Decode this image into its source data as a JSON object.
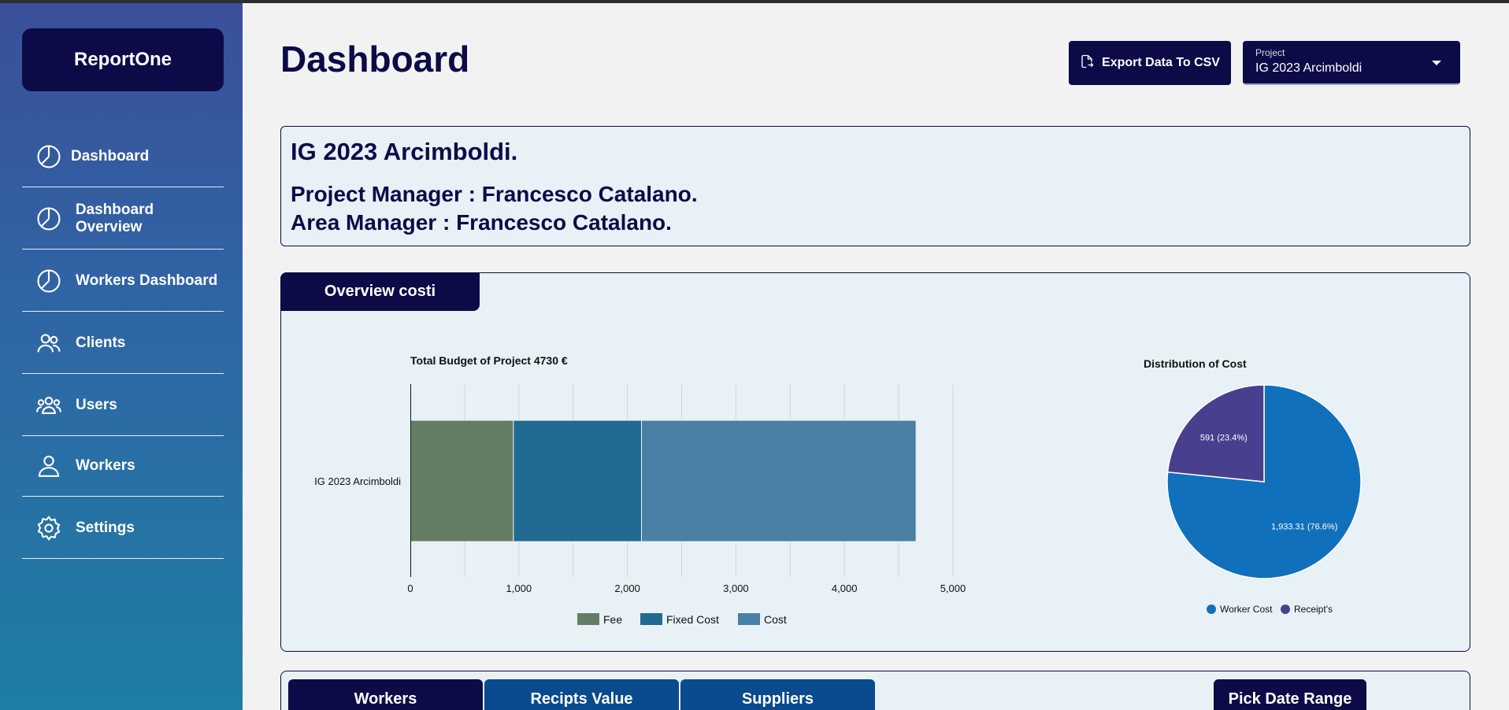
{
  "app": {
    "brand": "ReportOne"
  },
  "sidebar": {
    "items": [
      {
        "label": "Dashboard",
        "icon": "pie-chart-icon"
      },
      {
        "label": "Dashboard Overview",
        "icon": "pie-chart-icon"
      },
      {
        "label": "Workers Dashboard",
        "icon": "pie-chart-icon"
      },
      {
        "label": "Clients",
        "icon": "people-icon"
      },
      {
        "label": "Users",
        "icon": "group-icon"
      },
      {
        "label": "Workers",
        "icon": "person-icon"
      },
      {
        "label": "Settings",
        "icon": "gear-icon"
      }
    ]
  },
  "header": {
    "title": "Dashboard",
    "export_label": "Export Data To CSV",
    "export_icon": "file-export-icon",
    "project_select": {
      "label": "Project",
      "value": "IG 2023 Arcimboldi"
    }
  },
  "info": {
    "title": "IG 2023 Arcimboldi.",
    "project_manager": "Project Manager : Francesco Catalano.",
    "area_manager": "Area Manager : Francesco Catalano."
  },
  "overview": {
    "tab_label": "Overview costi"
  },
  "colors": {
    "navy": "#0d0b47",
    "fee": "#647d64",
    "fixed_cost": "#216a91",
    "cost": "#4a80a3",
    "worker_cost": "#1070bc",
    "receipts": "#48408e"
  },
  "chart_data": [
    {
      "type": "bar",
      "orientation": "horizontal",
      "stacked": true,
      "title": "Total Budget of Project 4730 €",
      "categories": [
        "IG 2023 Arcimboldi"
      ],
      "series": [
        {
          "name": "Fee",
          "values": [
            950
          ]
        },
        {
          "name": "Fixed Cost",
          "values": [
            1180
          ]
        },
        {
          "name": "Cost",
          "values": [
            2530
          ]
        }
      ],
      "xlim": [
        0,
        5000
      ],
      "x_ticks": [
        "0",
        "1,000",
        "2,000",
        "3,000",
        "4,000",
        "5,000"
      ],
      "grid": true,
      "legend": "bottom"
    },
    {
      "type": "pie",
      "title": "Distribution of Cost",
      "slices": [
        {
          "name": "Worker Cost",
          "value": 1933.31,
          "label": "1,933.31 (76.6%)"
        },
        {
          "name": "Receipt's",
          "value": 591,
          "label": "591 (23.4%)"
        }
      ],
      "legend": "bottom"
    }
  ],
  "bottom_tabs": {
    "items": [
      {
        "label": "Workers",
        "color": "#0d0b47"
      },
      {
        "label": "Recipts Value",
        "color": "#0a4a8e"
      },
      {
        "label": "Suppliers",
        "color": "#0a4a8e"
      }
    ],
    "date_range_label": "Pick Date Range"
  }
}
